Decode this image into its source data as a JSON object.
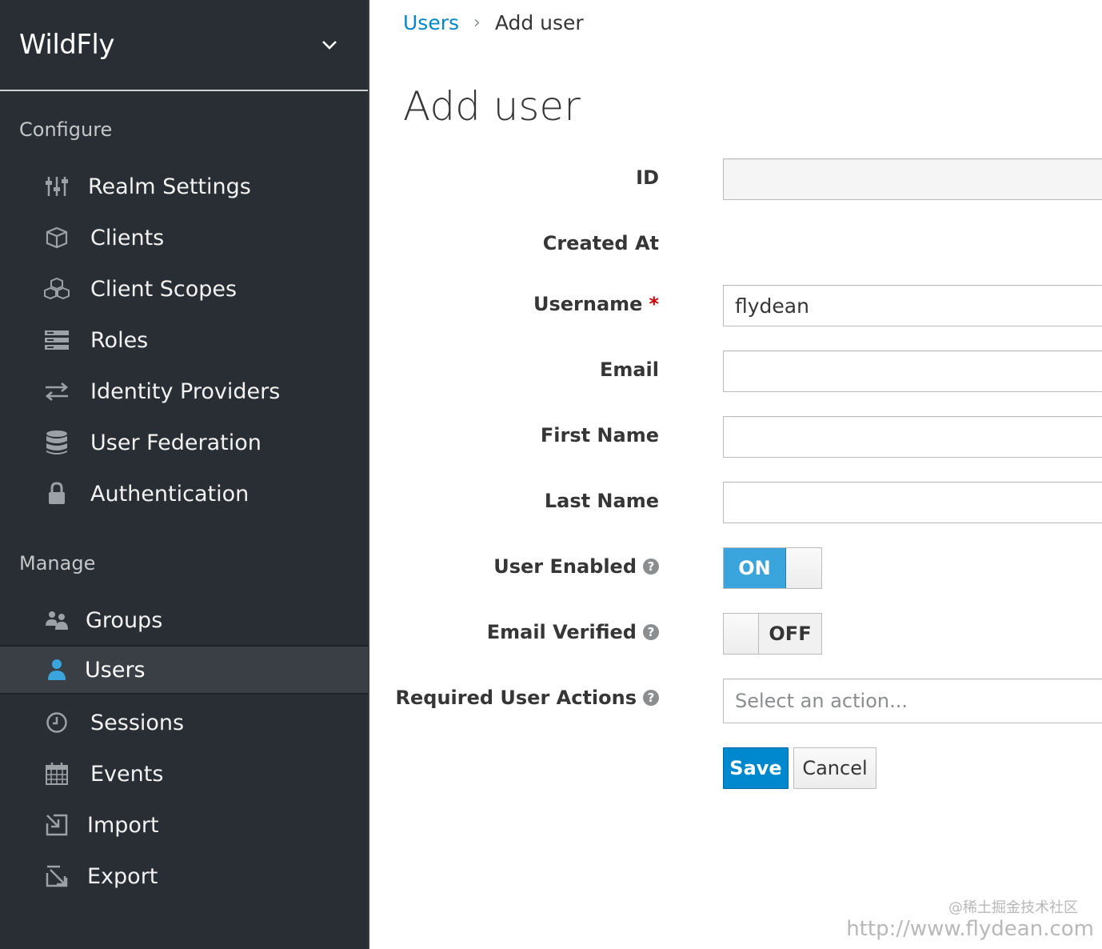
{
  "sidebar": {
    "realm_name": "WildFly",
    "configure_title": "Configure",
    "manage_title": "Manage",
    "configure_items": [
      {
        "label": "Realm Settings",
        "icon": "sliders-icon"
      },
      {
        "label": "Clients",
        "icon": "cube-icon"
      },
      {
        "label": "Client Scopes",
        "icon": "cubes-icon"
      },
      {
        "label": "Roles",
        "icon": "list-icon"
      },
      {
        "label": "Identity Providers",
        "icon": "exchange-icon"
      },
      {
        "label": "User Federation",
        "icon": "database-icon"
      },
      {
        "label": "Authentication",
        "icon": "lock-icon"
      }
    ],
    "manage_items": [
      {
        "label": "Groups",
        "icon": "users-icon"
      },
      {
        "label": "Users",
        "icon": "user-icon",
        "active": true
      },
      {
        "label": "Sessions",
        "icon": "clock-icon"
      },
      {
        "label": "Events",
        "icon": "calendar-icon"
      },
      {
        "label": "Import",
        "icon": "import-icon"
      },
      {
        "label": "Export",
        "icon": "export-icon"
      }
    ]
  },
  "breadcrumb": {
    "parent": "Users",
    "current": "Add user"
  },
  "page_title": "Add user",
  "form": {
    "id_label": "ID",
    "id_value": "",
    "created_at_label": "Created At",
    "username_label": "Username",
    "username_required": "*",
    "username_value": "flydean",
    "email_label": "Email",
    "email_value": "",
    "first_name_label": "First Name",
    "first_name_value": "",
    "last_name_label": "Last Name",
    "last_name_value": "",
    "user_enabled_label": "User Enabled",
    "user_enabled_state": "ON",
    "email_verified_label": "Email Verified",
    "email_verified_state": "OFF",
    "required_actions_label": "Required User Actions",
    "required_actions_placeholder": "Select an action...",
    "help_glyph": "?",
    "save_label": "Save",
    "cancel_label": "Cancel"
  },
  "watermark": {
    "line1": "@稀土掘金技术社区",
    "line2": "http://www.flydean.com"
  },
  "colors": {
    "sidebar_bg": "#292e34",
    "accent": "#0088ce",
    "toggle_on": "#39a5dc",
    "active_icon": "#39a5dc"
  }
}
